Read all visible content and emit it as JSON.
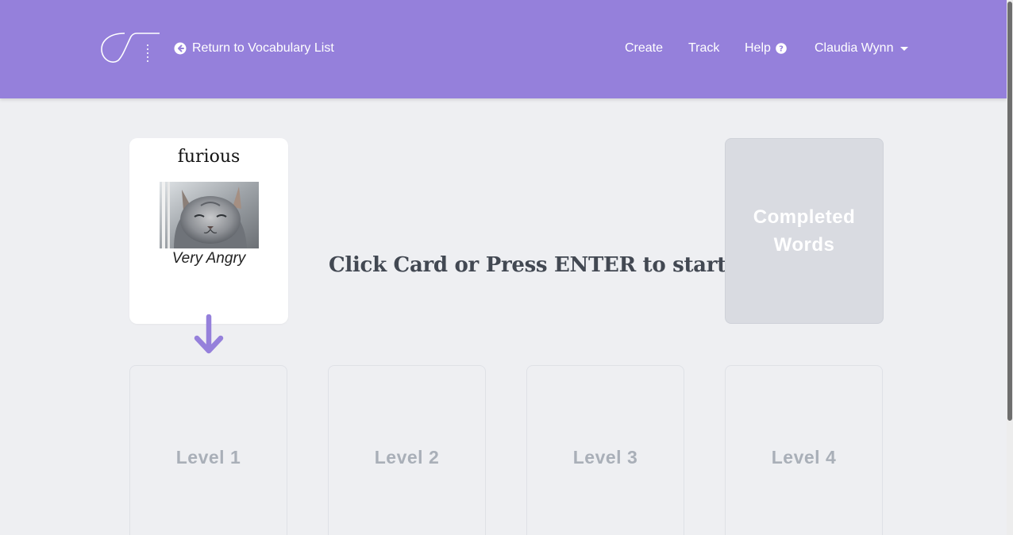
{
  "header": {
    "back_link": "Return to Vocabulary List",
    "nav": {
      "create": "Create",
      "track": "Track",
      "help": "Help",
      "user": "Claudia Wynn"
    },
    "background_color": "#9580db"
  },
  "card": {
    "word": "furious",
    "definition": "Very Angry"
  },
  "prompt": "Click Card or Press ENTER to start!",
  "completed": {
    "line1": "Completed",
    "line2": "Words"
  },
  "levels": [
    {
      "label": "Level 1"
    },
    {
      "label": "Level 2"
    },
    {
      "label": "Level 3"
    },
    {
      "label": "Level 4"
    }
  ],
  "icons": {
    "back": "arrow-circle-left-icon",
    "help": "question-circle-icon",
    "user_menu": "caret-down-icon",
    "guide": "arrow-down-icon"
  }
}
